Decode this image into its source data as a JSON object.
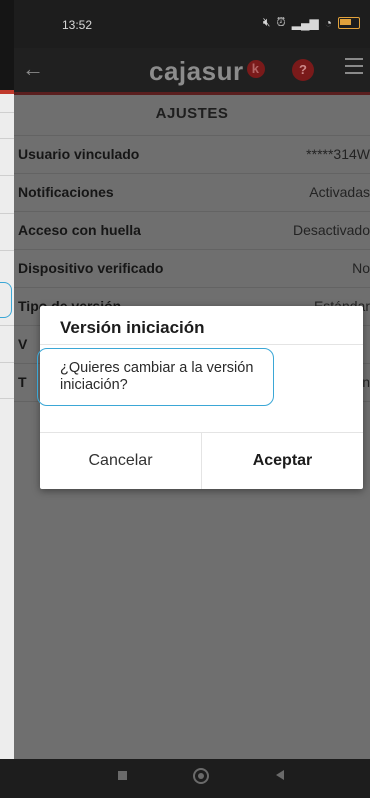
{
  "status_bar": {
    "time": "13:52"
  },
  "app_bar": {
    "logo_text": "cajasur",
    "logo_badge": "k",
    "help_label": "?"
  },
  "settings": {
    "title": "AJUSTES",
    "rows": [
      {
        "label": "Usuario vinculado",
        "value": "*****314W"
      },
      {
        "label": "Notificaciones",
        "value": "Activadas"
      },
      {
        "label": "Acceso con huella",
        "value": "Desactivado"
      },
      {
        "label": "Dispositivo verificado",
        "value": "No"
      },
      {
        "label": "Tipo de versión",
        "value": "Estándar"
      },
      {
        "label": "V",
        "value": ""
      },
      {
        "label": "T",
        "value": "n"
      }
    ]
  },
  "dialog": {
    "title": "Versión iniciación",
    "message": "¿Quieres cambiar a la versión iniciación?",
    "cancel_label": "Cancelar",
    "accept_label": "Aceptar"
  },
  "colors": {
    "accent": "#3ba7d6",
    "brand_red": "#c0392b",
    "overlay_content": "#6f6f6f"
  }
}
